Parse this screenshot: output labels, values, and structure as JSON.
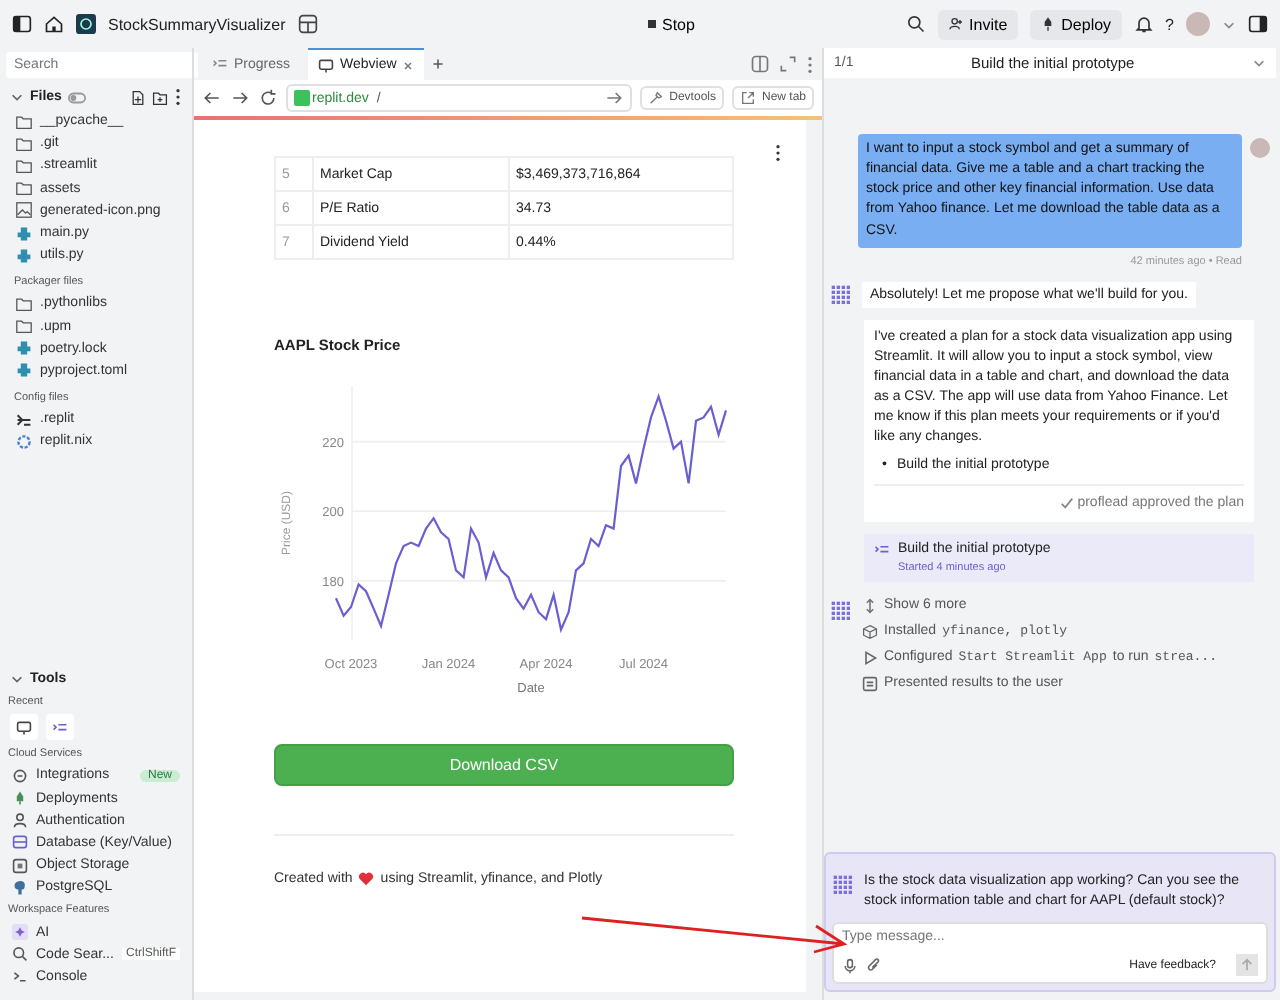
{
  "topbar": {
    "project": "StockSummaryVisualizer",
    "stop": "Stop",
    "invite": "Invite",
    "deploy": "Deploy",
    "help": "?"
  },
  "search": {
    "placeholder": "Search"
  },
  "files": {
    "title": "Files",
    "items": [
      {
        "name": "__pycache__",
        "kind": "folder"
      },
      {
        "name": ".git",
        "kind": "folder"
      },
      {
        "name": ".streamlit",
        "kind": "folder"
      },
      {
        "name": "assets",
        "kind": "folder"
      },
      {
        "name": "generated-icon.png",
        "kind": "image"
      },
      {
        "name": "main.py",
        "kind": "python"
      },
      {
        "name": "utils.py",
        "kind": "python"
      }
    ]
  },
  "packager": {
    "title": "Packager files",
    "items": [
      {
        "name": ".pythonlibs",
        "kind": "folder"
      },
      {
        "name": ".upm",
        "kind": "folder"
      },
      {
        "name": "poetry.lock",
        "kind": "python"
      },
      {
        "name": "pyproject.toml",
        "kind": "python"
      }
    ]
  },
  "config": {
    "title": "Config files",
    "items": [
      {
        "name": ".replit",
        "kind": "shell"
      },
      {
        "name": "replit.nix",
        "kind": "nix"
      }
    ]
  },
  "tools": {
    "title": "Tools",
    "recent_label": "Recent",
    "cloud_label": "Cloud Services",
    "workspace_label": "Workspace Features",
    "cloud": [
      {
        "name": "Integrations",
        "kind": "integrations",
        "badge": "New"
      },
      {
        "name": "Deployments",
        "kind": "deployments"
      },
      {
        "name": "Authentication",
        "kind": "auth"
      },
      {
        "name": "Database (Key/Value)",
        "kind": "database"
      },
      {
        "name": "Object Storage",
        "kind": "storage"
      },
      {
        "name": "PostgreSQL",
        "kind": "postgres"
      }
    ],
    "workspace": [
      {
        "name": "AI",
        "kind": "ai"
      },
      {
        "name": "Code Sear...",
        "kind": "search",
        "shortcut": "CtrlShiftF"
      },
      {
        "name": "Console",
        "kind": "console"
      }
    ]
  },
  "tabs": [
    {
      "label": "Progress",
      "kind": "progress",
      "selected": false
    },
    {
      "label": "Webview",
      "kind": "webview",
      "selected": true
    }
  ],
  "address": {
    "domain": "replit.dev",
    "path": "/",
    "devtools": "Devtools",
    "new_tab": "New tab"
  },
  "table": {
    "rows": [
      {
        "index": "5",
        "metric": "Market Cap",
        "value": "$3,469,373,716,864"
      },
      {
        "index": "6",
        "metric": "P/E Ratio",
        "value": "34.73"
      },
      {
        "index": "7",
        "metric": "Dividend Yield",
        "value": "0.44%"
      }
    ]
  },
  "chart_title": "AAPL Stock Price",
  "chart_data": {
    "type": "line",
    "xlabel": "Date",
    "ylabel": "Price (USD)",
    "grid": true,
    "ylim": [
      163,
      236
    ],
    "yticks": [
      180,
      200,
      220
    ],
    "categories": [
      null,
      null,
      "Oct 2023",
      null,
      null,
      null,
      null,
      null,
      null,
      null,
      null,
      null,
      null,
      null,
      null,
      "Jan 2024",
      null,
      null,
      null,
      null,
      null,
      null,
      null,
      null,
      null,
      null,
      null,
      null,
      "Apr 2024",
      null,
      null,
      null,
      null,
      null,
      null,
      null,
      null,
      null,
      null,
      null,
      null,
      "Jul 2024",
      null,
      null,
      null,
      null,
      null,
      null,
      null,
      null,
      null,
      null,
      null
    ],
    "series": [
      {
        "color": "#6a5fd0",
        "values": [
          175,
          170,
          172.5,
          179,
          177,
          172,
          167,
          176,
          185,
          190,
          191,
          190,
          195,
          198,
          194,
          192,
          183,
          181,
          195,
          191,
          181,
          188,
          183,
          181,
          175,
          172,
          176,
          171,
          169,
          176,
          166,
          171,
          183,
          185,
          192,
          190,
          196,
          195,
          213,
          216,
          208,
          218,
          227,
          233,
          226,
          218,
          220,
          208,
          226,
          227,
          230,
          222,
          229
        ]
      }
    ]
  },
  "download": "Download CSV",
  "footer": {
    "before": "Created with",
    "after": "using Streamlit, yfinance, and Plotly"
  },
  "chat": {
    "pager": "1/1",
    "title": "Build the initial prototype",
    "user_message": "I want to input a stock symbol and get a summary of financial data. Give me a table and a chart tracking the stock price and other key financial information. Use data from Yahoo finance. Let me download the table data as a CSV.",
    "user_meta": "42 minutes ago • Read",
    "agent_intro": "Absolutely! Let me propose what we'll build for you.",
    "plan_text": "I've created a plan for a stock data visualization app using Streamlit. It will allow you to input a stock symbol, view financial data in a table and chart, and download the data as a CSV. The app will use data from Yahoo Finance. Let me know if this plan meets your requirements or if you'd like any changes.",
    "plan_items": [
      {
        "bullet": "•",
        "text": "Build the initial prototype"
      }
    ],
    "approved": "proflead approved the plan",
    "task": {
      "title": "Build the initial prototype",
      "status": "Started 4 minutes ago"
    },
    "show_more": "Show 6 more",
    "actions": [
      {
        "kind": "install",
        "parts": [
          {
            "text": "Installed",
            "code": false
          },
          {
            "text": "yfinance, plotly",
            "code": true
          }
        ]
      },
      {
        "kind": "run",
        "parts": [
          {
            "text": "Configured",
            "code": false
          },
          {
            "text": "Start Streamlit App",
            "code": true
          },
          {
            "text": "to run",
            "code": false
          },
          {
            "text": "strea...",
            "code": true
          }
        ]
      },
      {
        "kind": "present",
        "parts": [
          {
            "text": "Presented results to the user",
            "code": false
          }
        ]
      }
    ],
    "question": "Is the stock data visualization app working? Can you see the stock information table and chart for AAPL (default stock)?",
    "input_placeholder": "Type message...",
    "feedback": "Have feedback?"
  }
}
